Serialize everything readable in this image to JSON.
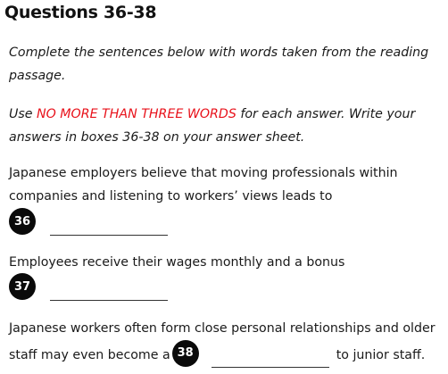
{
  "title": "Questions 36-38",
  "instructions": {
    "line1": "Complete the sentences below with words taken from the reading passage.",
    "limit_prefix": "Use ",
    "limit_highlight": "NO MORE THAN THREE WORDS",
    "limit_suffix": " for each answer. Write your answers in boxes 36-38 on your answer sheet."
  },
  "questions": [
    {
      "number": "36",
      "text": "Japanese employers believe that moving professionals within companies and listening to workers’ views leads to",
      "answer": ""
    },
    {
      "number": "37",
      "text": "Employees receive their wages monthly and a bonus",
      "answer": ""
    },
    {
      "number": "38",
      "text_before": "Japanese workers often form close personal relationships and older staff may even become a",
      "text_after": "to junior staff.",
      "answer": ""
    }
  ],
  "colors": {
    "accent": "#e8121b",
    "badge": "#0a0a0a"
  }
}
